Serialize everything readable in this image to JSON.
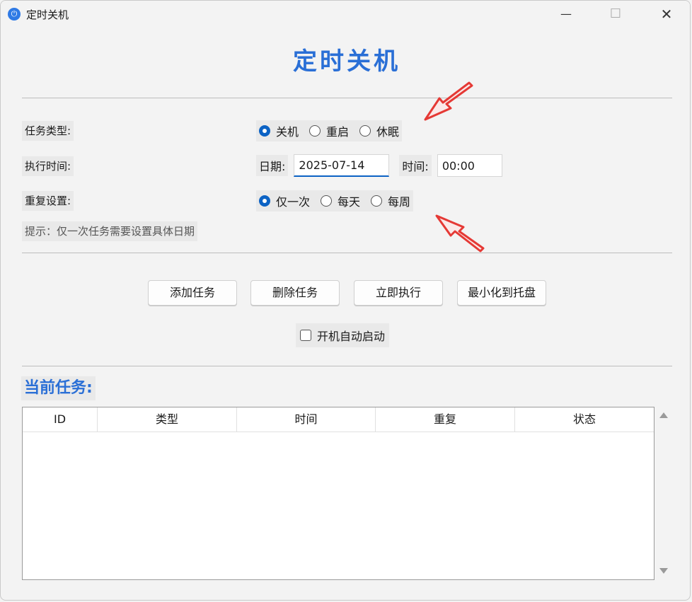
{
  "window": {
    "title": "定时关机"
  },
  "header": {
    "title": "定时关机"
  },
  "form": {
    "task_type": {
      "label": "任务类型:",
      "options": [
        "关机",
        "重启",
        "休眠"
      ],
      "selected": "关机"
    },
    "exec_time": {
      "label": "执行时间:",
      "date_label": "日期:",
      "date_value": "2025-07-14",
      "time_label": "时间:",
      "time_value": "00:00"
    },
    "repeat": {
      "label": "重复设置:",
      "options": [
        "仅一次",
        "每天",
        "每周"
      ],
      "selected": "仅一次"
    },
    "hint": "提示：仅一次任务需要设置具体日期"
  },
  "actions": {
    "add": "添加任务",
    "delete": "删除任务",
    "run_now": "立即执行",
    "minimize_tray": "最小化到托盘",
    "autostart": "开机自动启动"
  },
  "tasks": {
    "title": "当前任务:",
    "columns": [
      "ID",
      "类型",
      "时间",
      "重复",
      "状态"
    ],
    "rows": []
  },
  "colors": {
    "accent": "#2a6fd6",
    "radio": "#0b62c4",
    "annotation": "#e53935"
  },
  "icons": [
    "app-icon",
    "minimize-icon",
    "maximize-icon",
    "close-icon",
    "red-arrow-icon"
  ]
}
